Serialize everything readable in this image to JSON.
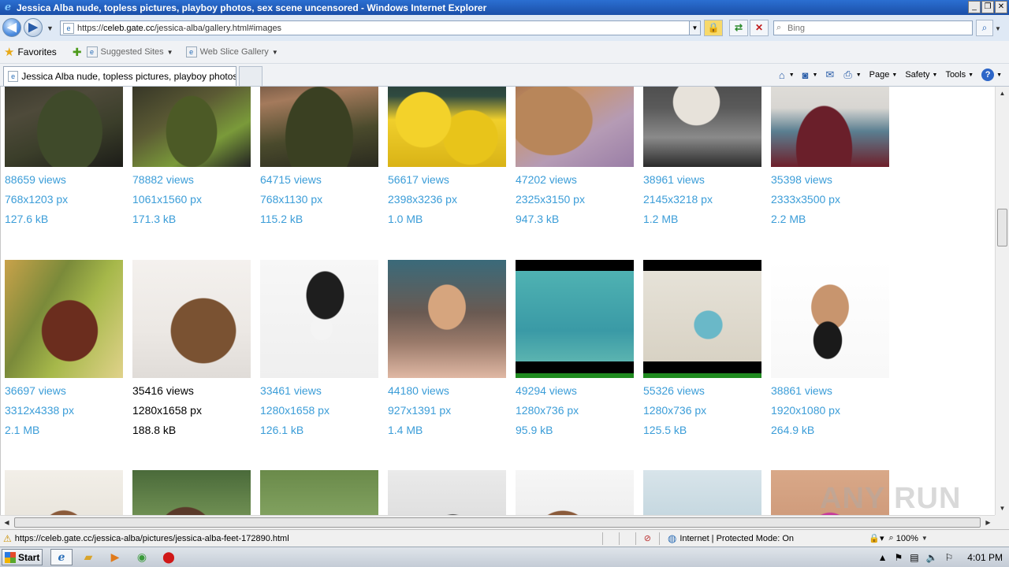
{
  "window": {
    "title": "Jessica Alba nude, topless pictures, playboy photos, sex scene uncensored - Windows Internet Explorer",
    "min_glyph": "_",
    "restore_glyph": "❐",
    "close_glyph": "✕"
  },
  "address": {
    "url_prefix": "https://",
    "url_host": "celeb.gate.cc",
    "url_path": "/jessica-alba/gallery.html#images"
  },
  "search": {
    "placeholder": "Bing"
  },
  "favorites": {
    "label": "Favorites",
    "items": [
      {
        "label": "Suggested Sites"
      },
      {
        "label": "Web Slice Gallery"
      }
    ]
  },
  "tab": {
    "label": "Jessica Alba nude, topless pictures, playboy photos, ..."
  },
  "commands": {
    "page": "Page",
    "safety": "Safety",
    "tools": "Tools",
    "help": "?"
  },
  "gallery": {
    "rows": [
      [
        {
          "views": "88659 views",
          "dims": "768x1203 px",
          "size": "127.6 kB"
        },
        {
          "views": "78882 views",
          "dims": "1061x1560 px",
          "size": "171.3 kB"
        },
        {
          "views": "64715 views",
          "dims": "768x1130 px",
          "size": "115.2 kB"
        },
        {
          "views": "56617 views",
          "dims": "2398x3236 px",
          "size": "1.0 MB"
        },
        {
          "views": "47202 views",
          "dims": "2325x3150 px",
          "size": "947.3 kB"
        },
        {
          "views": "38961 views",
          "dims": "2145x3218 px",
          "size": "1.2 MB"
        },
        {
          "views": "35398 views",
          "dims": "2333x3500 px",
          "size": "2.2 MB"
        }
      ],
      [
        {
          "views": "36697 views",
          "dims": "3312x4338 px",
          "size": "2.1 MB"
        },
        {
          "views": "35416 views",
          "dims": "1280x1658 px",
          "size": "188.8 kB"
        },
        {
          "views": "33461 views",
          "dims": "1280x1658 px",
          "size": "126.1 kB"
        },
        {
          "views": "44180 views",
          "dims": "927x1391 px",
          "size": "1.4 MB"
        },
        {
          "views": "49294 views",
          "dims": "1280x736 px",
          "size": "95.9 kB"
        },
        {
          "views": "55326 views",
          "dims": "1280x736 px",
          "size": "125.5 kB"
        },
        {
          "views": "38861 views",
          "dims": "1920x1080 px",
          "size": "264.9 kB"
        }
      ]
    ]
  },
  "status": {
    "url": "https://celeb.gate.cc/jessica-alba/pictures/jessica-alba-feet-172890.html",
    "zone": "Internet | Protected Mode: On",
    "zoom": "100%"
  },
  "taskbar": {
    "start": "Start",
    "clock": "4:01 PM"
  },
  "watermark": "ANY RUN",
  "colors": {
    "link": "#3b9dd8",
    "titlebar": "#1b4fa8"
  }
}
